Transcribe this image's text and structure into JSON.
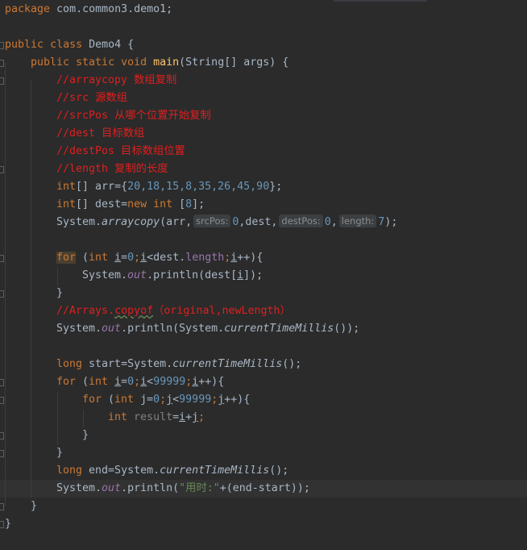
{
  "code": {
    "l1_package_kw": "package",
    "l1_rest": " com.common3.demo1;",
    "l3_public": "public",
    "l3_class": "class",
    "l3_name": " Demo4 {",
    "l4_mods": "public static void",
    "l4_main": "main",
    "l4_params": "(String[] args) {",
    "l5": "//arraycopy 数组复制",
    "l6": "//src 源数组",
    "l7": "//srcPos 从哪个位置开始复制",
    "l8": "//dest 目标数组",
    "l9": "//destPos 目标数组位置",
    "l10": "//length 复制的长度",
    "l11_type": "int",
    "l11_a": "[] arr={",
    "l11_nums": "20,18,15,8,35,26,45,90",
    "l11_b": "};",
    "l12_type": "int",
    "l12_a": "[] dest=",
    "l12_new": "new int",
    "l12_b": " [",
    "l12_num": "8",
    "l12_c": "];",
    "l13_a": "System.",
    "l13_m": "arraycopy",
    "l13_b": "(arr,",
    "l13_hint1": "srcPos:",
    "l13_v1": "0",
    "l13_c": ",dest,",
    "l13_hint2": "destPos:",
    "l13_v2": "0",
    "l13_d": ",",
    "l13_hint3": "length:",
    "l13_v3": "7",
    "l13_e": ");",
    "l15_for": "for",
    "l15_a": " (",
    "l15_int": "int",
    "l15_i1": "i",
    "l15_b": "=",
    "l15_0": "0",
    "l15_semi1": ";",
    "l15_i2": "i",
    "l15_c": "<dest.",
    "l15_len": "length",
    "l15_semi2": ";",
    "l15_i3": "i",
    "l15_d": "++){",
    "l16_a": "System.",
    "l16_out": "out",
    "l16_b": ".println(dest[",
    "l16_i": "i",
    "l16_c": "]);",
    "l17": "}",
    "l18_a": "//Arrays.",
    "l18_copyof": "copyof",
    "l18_b": "（original,newLength）",
    "l19_a": "System.",
    "l19_out": "out",
    "l19_b": ".println(System.",
    "l19_m": "currentTimeMillis",
    "l19_c": "());",
    "l21_long": "long",
    "l21_a": " start=System.",
    "l21_m": "currentTimeMillis",
    "l21_b": "();",
    "l22_for": "for",
    "l22_a": " (",
    "l22_int": "int",
    "l22_i1": "i",
    "l22_b": "=",
    "l22_0": "0",
    "l22_semi1": ";",
    "l22_i2": "i",
    "l22_c": "<",
    "l22_n": "99999",
    "l22_semi2": ";",
    "l22_i3": "i",
    "l22_d": "++){",
    "l23_for": "for",
    "l23_a": " (",
    "l23_int": "int",
    "l23_b": " j=",
    "l23_0": "0",
    "l23_semi1": ";",
    "l23_j2": "j",
    "l23_c": "<",
    "l23_n": "99999",
    "l23_semi2": ";",
    "l23_j3": "j",
    "l23_d": "++){",
    "l24_int": "int",
    "l24_var": "result",
    "l24_a": "=",
    "l24_i": "i",
    "l24_b": "+",
    "l24_j": "j",
    "l24_semi": ";",
    "l25": "}",
    "l26": "}",
    "l27_long": "long",
    "l27_a": " end=System.",
    "l27_m": "currentTimeMillis",
    "l27_b": "();",
    "l28_a": "System.",
    "l28_out": "out",
    "l28_b": ".println(",
    "l28_str": "\"用时:\"",
    "l28_c": "+(end-start));",
    "l29": "}",
    "l30": "}"
  },
  "colors": {
    "background": "#2b2b2b",
    "keyword": "#cc7832",
    "comment": "#e01f1f",
    "number": "#6897bb",
    "method": "#ffc66d",
    "field": "#9876aa",
    "string": "#6a8759"
  }
}
